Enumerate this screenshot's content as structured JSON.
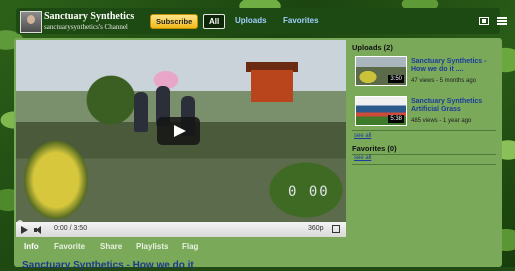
{
  "header": {
    "channel_name": "Sanctuary Synthetics",
    "channel_subtitle": "sanctuarysynthetics's Channel",
    "subscribe_label": "Subscribe",
    "nav": {
      "all": "All",
      "uploads": "Uploads",
      "favorites": "Favorites"
    }
  },
  "player": {
    "overlay_timestamp": "0 00",
    "time": "0:00 / 3:50",
    "quality": "360p",
    "progress_fraction": 0
  },
  "tabs": [
    "Info",
    "Favorite",
    "Share",
    "Playlists",
    "Flag"
  ],
  "description": {
    "title": "Sanctuary Synthetics - How we do it"
  },
  "sidebar": {
    "uploads_heading": "Uploads (2)",
    "uploads": [
      {
        "title": "Sanctuary Synthetics - How we do it ....",
        "meta": "47 views - 5 months ago",
        "duration": "3:50"
      },
      {
        "title": "Sanctuary Synthetics Artificial Grass",
        "meta": "485 views - 1 year ago",
        "duration": "5:38"
      }
    ],
    "uploads_see_all": "see all",
    "favorites_heading": "Favorites (0)",
    "favorites_see_all": "see all"
  },
  "colors": {
    "header_bg": "#1d4a12",
    "panel_bg": "#7aa95a",
    "link": "#1d3b9c",
    "subscribe": "#f2b81a"
  }
}
